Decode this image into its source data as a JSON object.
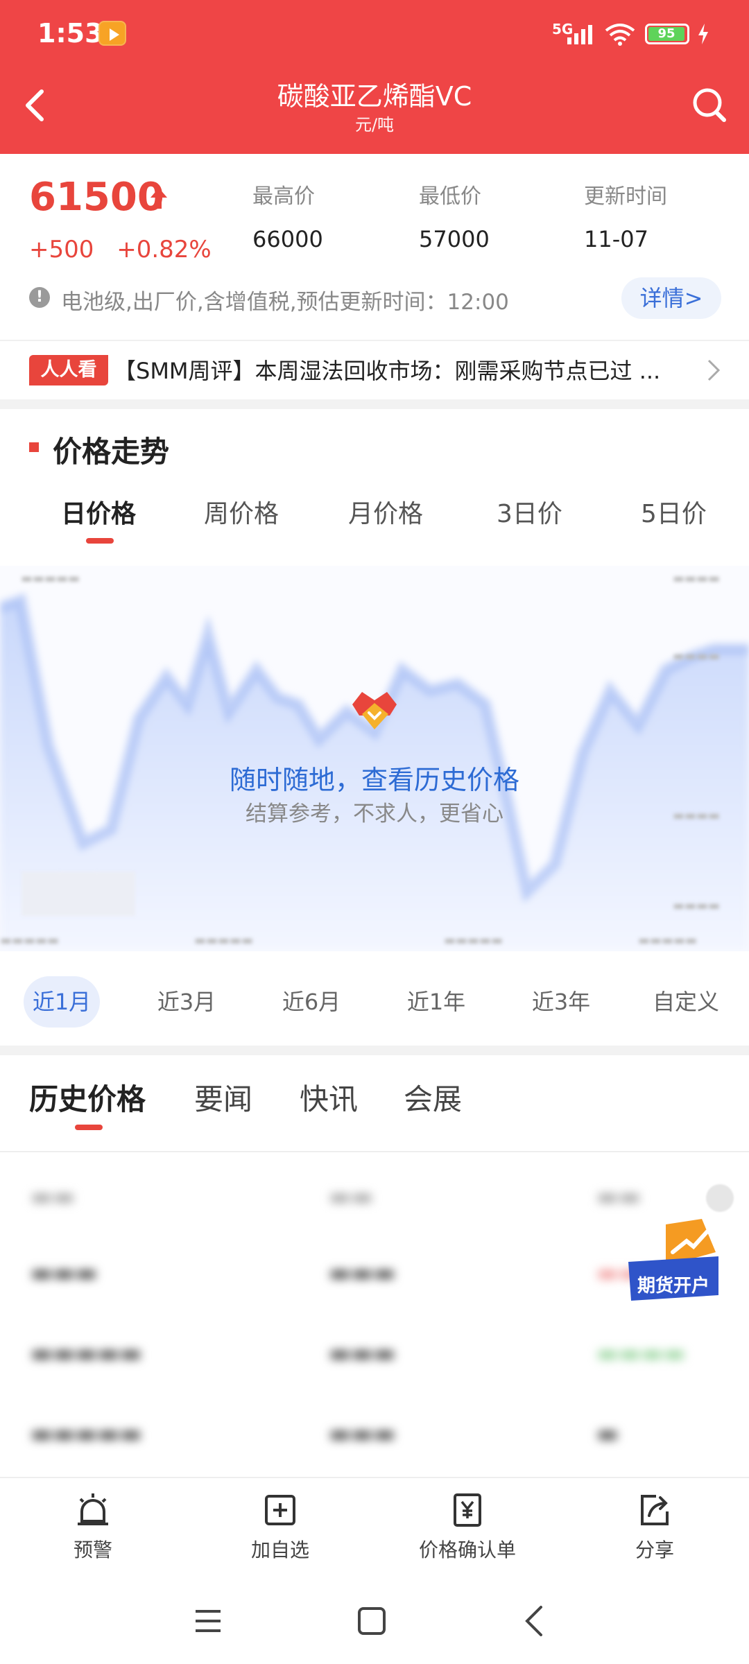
{
  "status_bar": {
    "time": "1:53",
    "network": "5G",
    "battery": "95"
  },
  "header": {
    "title": "碳酸亚乙烯酯VC",
    "unit": "元/吨"
  },
  "price": {
    "current": "61500",
    "change": "+500",
    "change_pct": "+0.82%",
    "high_label": "最高价",
    "high": "66000",
    "low_label": "最低价",
    "low": "57000",
    "updated_label": "更新时间",
    "updated": "11-07",
    "notice": "电池级,出厂价,含增值税,预估更新时间：12:00",
    "detail_btn": "详情>"
  },
  "ticker": {
    "tag": "人人看",
    "text": "【SMM周评】本周湿法回收市场：刚需采购节点已过 ..."
  },
  "trend": {
    "title": "价格走势",
    "tabs": [
      "日价格",
      "周价格",
      "月价格",
      "3日价",
      "5日价"
    ],
    "active_tab": 0,
    "overlay_title": "随时随地，查看历史价格",
    "overlay_sub": "结算参考，不求人，更省心",
    "ranges": [
      "近1月",
      "近3月",
      "近6月",
      "近1年",
      "近3年",
      "自定义"
    ],
    "active_range": 0
  },
  "bottom_tabs": {
    "items": [
      "历史价格",
      "要闻",
      "快讯",
      "会展"
    ],
    "active": 0
  },
  "promo": {
    "label": "期货开户"
  },
  "toolbar": {
    "items": [
      {
        "label": "预警",
        "icon": "alarm-icon"
      },
      {
        "label": "加自选",
        "icon": "add-watchlist-icon"
      },
      {
        "label": "价格确认单",
        "icon": "price-confirm-icon"
      },
      {
        "label": "分享",
        "icon": "share-icon"
      }
    ]
  },
  "colors": {
    "brand_red": "#ef4546",
    "accent_blue": "#3a6fd8",
    "up_red": "#e8453c"
  }
}
